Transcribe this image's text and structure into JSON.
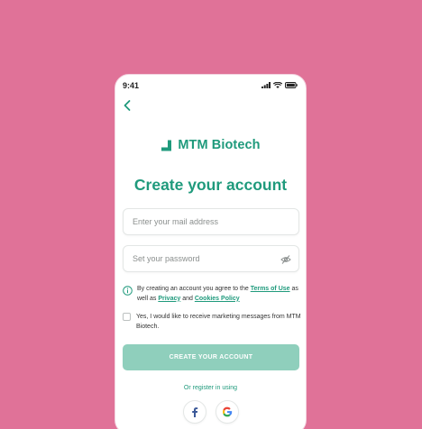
{
  "status_bar": {
    "time": "9:41"
  },
  "brand": {
    "name": "MTM Biotech",
    "color": "#1f9a7c"
  },
  "page": {
    "title": "Create your account"
  },
  "form": {
    "email_placeholder": "Enter your mail address",
    "password_placeholder": "Set your password"
  },
  "terms": {
    "prefix": "By creating an account you agree to the ",
    "terms_link": "Terms of Use",
    "middle": " as well as ",
    "privacy_link": "Privacy",
    "and": " and ",
    "cookies_link": "Cookies Policy"
  },
  "marketing": {
    "label": "Yes, I would like to receive marketing messages from MTM Biotech."
  },
  "cta": {
    "label": "CREATE YOUR ACCOUNT",
    "color": "#8fcfbc"
  },
  "social": {
    "label": "Or register in using",
    "providers": [
      "facebook-icon",
      "google-icon"
    ]
  },
  "colors": {
    "background": "#e07298",
    "accent": "#1f9a7c"
  }
}
